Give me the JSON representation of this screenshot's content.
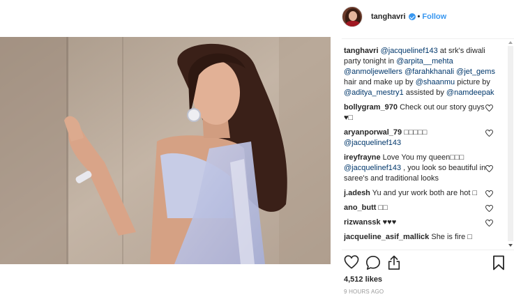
{
  "header": {
    "username": "tanghavri",
    "separator": "•",
    "follow_label": "Follow"
  },
  "caption": {
    "user": "tanghavri",
    "t1": " ",
    "m1": "@jacquelinef143",
    "t2": " at srk's diwali party tonight in ",
    "m2": "@arpita__mehta",
    "t3": " ",
    "m3": "@anmoljewellers",
    "t4": " ",
    "m4": "@farahkhanali",
    "t5": " ",
    "m5": "@jet_gems",
    "t6": " hair and make up by ",
    "m6": "@shaanmu",
    "t7": " picture by ",
    "m7": "@aditya_mestry1",
    "t8": " assisted by ",
    "m8": "@namdeepak"
  },
  "comments": [
    {
      "user": "bollygram_970",
      "text": " Check out our story guys ♥□"
    },
    {
      "user": "aryanporwal_79",
      "text": " □□□□□",
      "mention": "@jacquelinef143",
      "after": ""
    },
    {
      "user": "ireyfrayne",
      "text": " Love You my queen□□□",
      "mention": "@jacquelinef143",
      "after": " , you look so beautiful in saree's and traditional looks"
    },
    {
      "user": "j.adesh",
      "text": " Yu and yur work both are hot □"
    },
    {
      "user": "ano_butt",
      "text": " □□"
    },
    {
      "user": "rizwanssk",
      "text": " ♥♥♥"
    },
    {
      "user": "jacqueline_asif_mallick",
      "text": " She is fire □"
    }
  ],
  "likes": "4,512 likes",
  "time": "9 HOURS AGO",
  "icons": [
    "verified-badge-icon",
    "heart-icon",
    "comment-icon",
    "share-icon",
    "bookmark-icon"
  ],
  "colors": {
    "link": "#3897f0",
    "mention": "#00376b",
    "muted": "#999999"
  }
}
